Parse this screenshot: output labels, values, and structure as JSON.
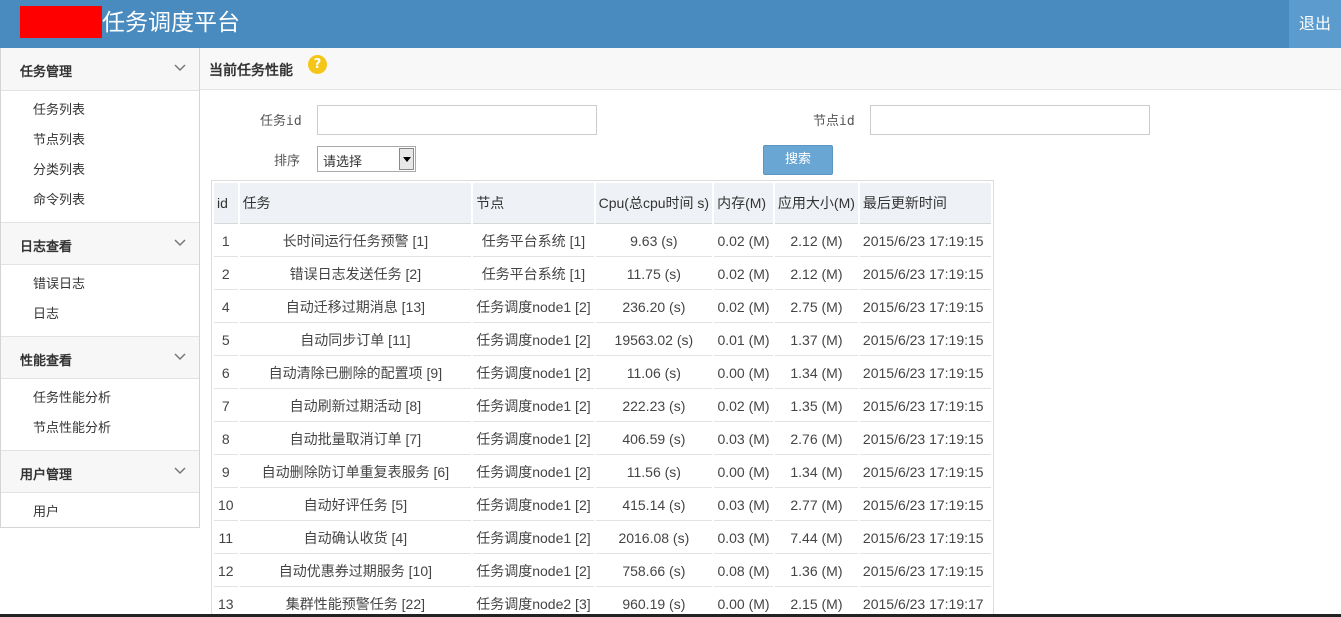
{
  "header": {
    "title": "任务调度平台",
    "logout_label": "退出",
    "colors": {
      "bar": "#4a8bbf",
      "logo_block": "#ff0000"
    }
  },
  "sidebar": {
    "groups": [
      {
        "label": "任务管理",
        "items": [
          {
            "label": "任务列表"
          },
          {
            "label": "节点列表"
          },
          {
            "label": "分类列表"
          },
          {
            "label": "命令列表"
          }
        ]
      },
      {
        "label": "日志查看",
        "items": [
          {
            "label": "错误日志"
          },
          {
            "label": "日志"
          }
        ]
      },
      {
        "label": "性能查看",
        "items": [
          {
            "label": "任务性能分析"
          },
          {
            "label": "节点性能分析"
          }
        ]
      },
      {
        "label": "用户管理",
        "items": [
          {
            "label": "用户"
          }
        ]
      }
    ]
  },
  "main": {
    "page_title": "当前任务性能",
    "help_icon": "?",
    "filters": {
      "task_id_label": "任务id",
      "task_id_value": "",
      "node_id_label": "节点id",
      "node_id_value": "",
      "sort_label": "排序",
      "sort_selected": "请选择",
      "search_label": "搜索"
    },
    "table": {
      "columns": [
        "id",
        "任务",
        "节点",
        "Cpu(总cpu时间 s)",
        "内存(M)",
        "应用大小(M)",
        "最后更新时间"
      ],
      "rows": [
        [
          "1",
          "长时间运行任务预警 [1]",
          "任务平台系统 [1]",
          "9.63 (s)",
          "0.02 (M)",
          "2.12 (M)",
          "2015/6/23 17:19:15"
        ],
        [
          "2",
          "错误日志发送任务 [2]",
          "任务平台系统 [1]",
          "11.75 (s)",
          "0.02 (M)",
          "2.12 (M)",
          "2015/6/23 17:19:15"
        ],
        [
          "4",
          "自动迁移过期消息 [13]",
          "任务调度node1 [2]",
          "236.20 (s)",
          "0.02 (M)",
          "2.75 (M)",
          "2015/6/23 17:19:15"
        ],
        [
          "5",
          "自动同步订单 [11]",
          "任务调度node1 [2]",
          "19563.02 (s)",
          "0.01 (M)",
          "1.37 (M)",
          "2015/6/23 17:19:15"
        ],
        [
          "6",
          "自动清除已删除的配置项 [9]",
          "任务调度node1 [2]",
          "11.06 (s)",
          "0.00 (M)",
          "1.34 (M)",
          "2015/6/23 17:19:15"
        ],
        [
          "7",
          "自动刷新过期活动 [8]",
          "任务调度node1 [2]",
          "222.23 (s)",
          "0.02 (M)",
          "1.35 (M)",
          "2015/6/23 17:19:15"
        ],
        [
          "8",
          "自动批量取消订单 [7]",
          "任务调度node1 [2]",
          "406.59 (s)",
          "0.03 (M)",
          "2.76 (M)",
          "2015/6/23 17:19:15"
        ],
        [
          "9",
          "自动删除防订单重复表服务 [6]",
          "任务调度node1 [2]",
          "11.56 (s)",
          "0.00 (M)",
          "1.34 (M)",
          "2015/6/23 17:19:15"
        ],
        [
          "10",
          "自动好评任务 [5]",
          "任务调度node1 [2]",
          "415.14 (s)",
          "0.03 (M)",
          "2.77 (M)",
          "2015/6/23 17:19:15"
        ],
        [
          "11",
          "自动确认收货 [4]",
          "任务调度node1 [2]",
          "2016.08 (s)",
          "0.03 (M)",
          "7.44 (M)",
          "2015/6/23 17:19:15"
        ],
        [
          "12",
          "自动优惠券过期服务 [10]",
          "任务调度node1 [2]",
          "758.66 (s)",
          "0.08 (M)",
          "1.36 (M)",
          "2015/6/23 17:19:15"
        ],
        [
          "13",
          "集群性能预警任务 [22]",
          "任务调度node2 [3]",
          "960.19 (s)",
          "0.00 (M)",
          "2.15 (M)",
          "2015/6/23 17:19:17"
        ]
      ]
    }
  }
}
